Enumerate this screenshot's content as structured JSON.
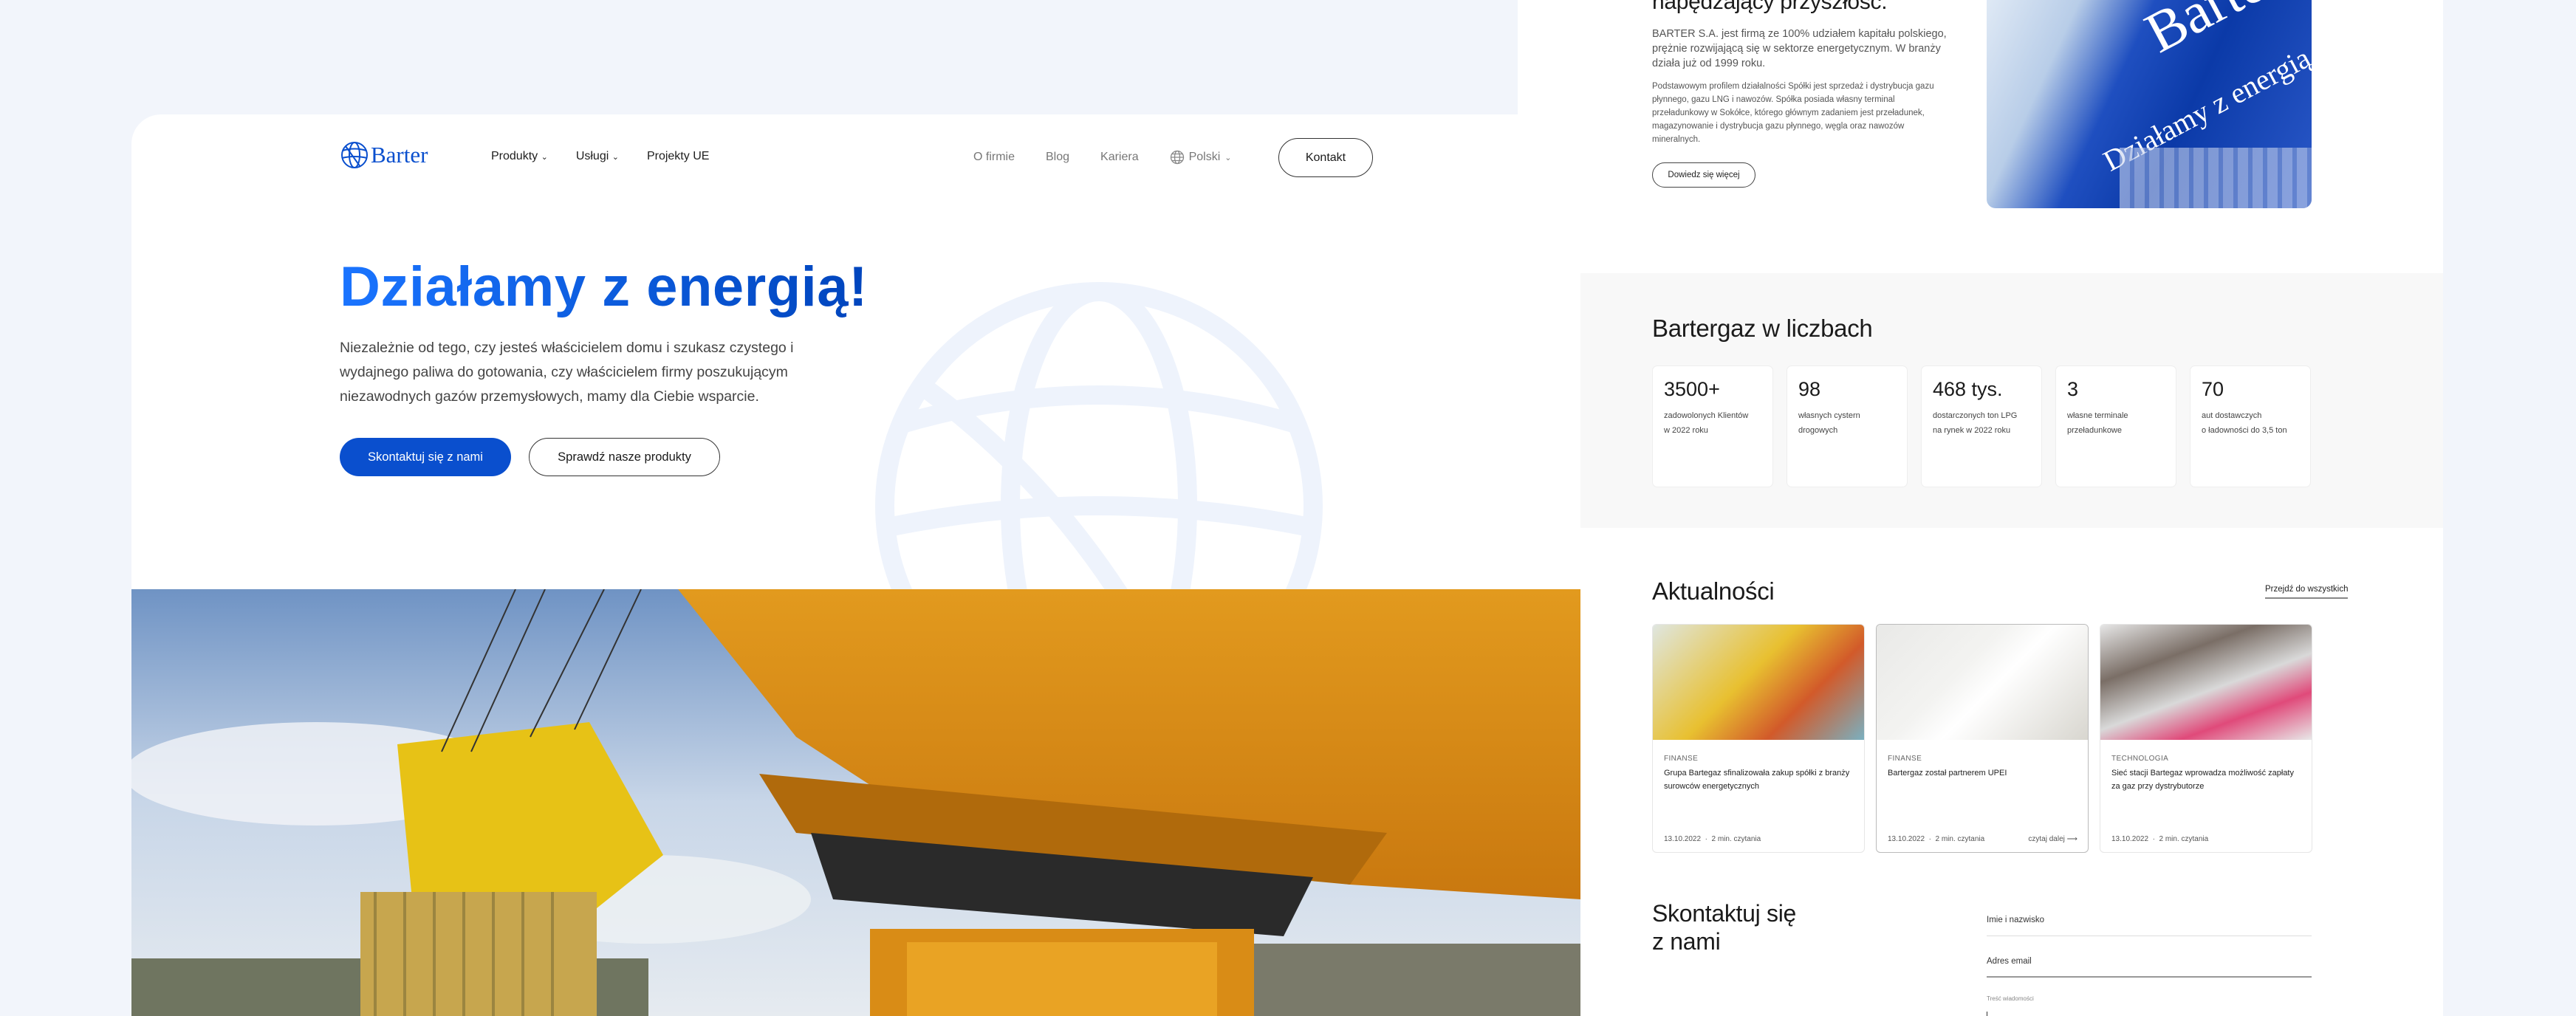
{
  "about": {
    "heading": "napędzający przyszłość.",
    "p1": "BARTER S.A. jest firmą ze 100% udziałem kapitału polskiego, prężnie rozwijającą się w sektorze energetycznym. W branży działa już od 1999 roku.",
    "p2": "Podstawowym profilem działalności Spółki jest sprzedaż i dystrybucja gazu płynnego, gazu LNG i nawozów. Spółka posiada własny terminal przeładunkowy w Sokółce, którego głównym zadaniem jest przeładunek, magazynowanie i dystrybucja gazu płynnego, węgla oraz nawozów mineralnych.",
    "button": "Dowiedz się więcej",
    "truck_brand": "Barter",
    "truck_slogan": "Działamy z energią"
  },
  "stats": {
    "heading": "Bartergaz w liczbach",
    "items": [
      {
        "value": "3500+",
        "line1": "zadowolonych Klientów",
        "line2": "w 2022 roku"
      },
      {
        "value": "98",
        "line1": "własnych cystern",
        "line2": "drogowych"
      },
      {
        "value": "468 tys.",
        "line1": "dostarczonych ton LPG",
        "line2": "na rynek w 2022 roku"
      },
      {
        "value": "3",
        "line1": "własne terminale",
        "line2": "przeładunkowe"
      },
      {
        "value": "70",
        "line1": "aut dostawczych",
        "line2": "o ładowności do 3,5 ton"
      }
    ]
  },
  "news": {
    "heading": "Aktualności",
    "all_link": "Przejdź do wszystkich",
    "read_more": "czytaj dalej",
    "items": [
      {
        "category": "FINANSE",
        "title": "Grupa Bartegaz sfinalizowała zakup spółki z branży surowców energetycznych",
        "date": "13.10.2022",
        "read": "2 min. czytania"
      },
      {
        "category": "FINANSE",
        "title": "Bartergaz został partnerem UPEI",
        "date": "13.10.2022",
        "read": "2 min. czytania"
      },
      {
        "category": "TECHNOLOGIA",
        "title": "Sieć stacji Bartegaz wprowadza możliwość zapłaty za gaz przy dystrybutorze",
        "date": "13.10.2022",
        "read": "2 min. czytania"
      }
    ]
  },
  "contact": {
    "heading_1": "Skontaktuj się",
    "heading_2": "z nami",
    "name_label": "Imie i nazwisko",
    "email_label": "Adres email",
    "message_label": "Treść wiadomości"
  },
  "header": {
    "logo": "Barter",
    "nav": [
      "Produkty",
      "Usługi",
      "Projekty UE"
    ],
    "nav_right": [
      "O firmie",
      "Blog",
      "Kariera"
    ],
    "language": "Polski",
    "contact_button": "Kontakt"
  },
  "hero": {
    "title": "Działamy z energią!",
    "text": "Niezależnie od tego, czy jesteś właścicielem domu i szukasz czystego i wydajnego paliwa do gotowania, czy właścicielem firmy poszukującym niezawodnych gazów przemysłowych, mamy dla Ciebie wsparcie.",
    "primary_button": "Skontaktuj się z nami",
    "secondary_button": "Sprawdź nasze produkty"
  },
  "colors": {
    "brand_blue": "#0a4fce",
    "background": "#f2f5fb"
  }
}
